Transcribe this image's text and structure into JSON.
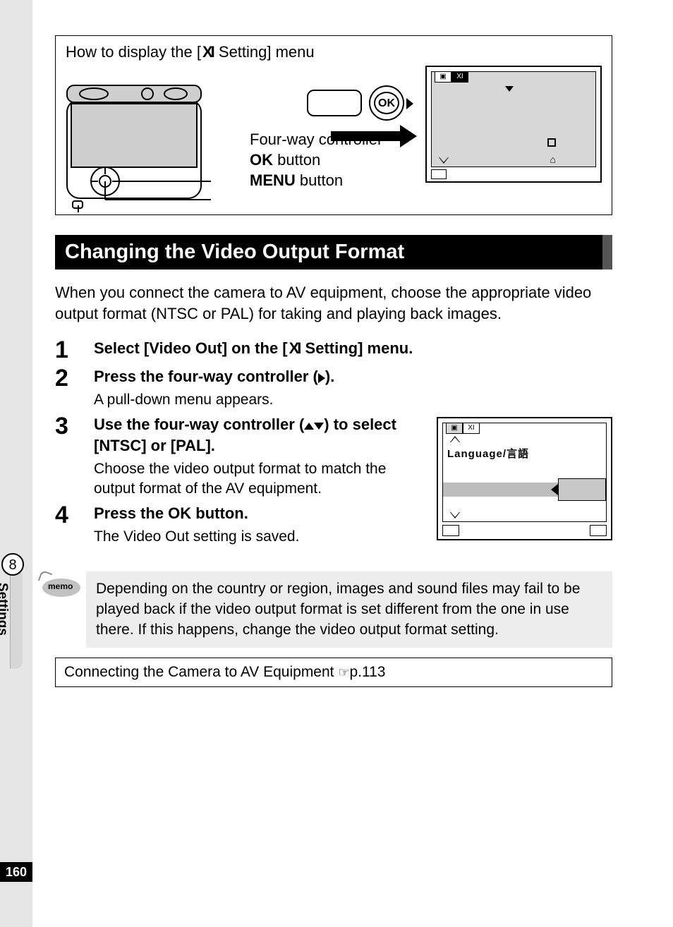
{
  "howto": {
    "title_prefix": "How to display the [",
    "title_suffix": " Setting] menu",
    "callouts": {
      "fourway": "Four-way controller",
      "ok_prefix": "OK",
      "ok_suffix": " button",
      "menu_prefix": "MENU",
      "menu_suffix": " button"
    },
    "ok_button_label": "OK"
  },
  "heading": "Changing the Video Output Format",
  "intro": "When you connect the camera to AV equipment, choose the appropriate video output format (NTSC or PAL) for taking and playing back images.",
  "steps": [
    {
      "num": "1",
      "title_prefix": "Select [Video Out] on the [",
      "title_suffix": " Setting] menu.",
      "desc": ""
    },
    {
      "num": "2",
      "title": "Press the four-way controller (▶).",
      "desc": "A pull-down menu appears."
    },
    {
      "num": "3",
      "title": "Use the four-way controller (▲▼) to select [NTSC] or [PAL].",
      "desc": "Choose the video output format to match the output format of the AV equipment."
    },
    {
      "num": "4",
      "title_prefix": "Press the ",
      "title_ok": "OK",
      "title_suffix": " button.",
      "desc": "The Video Out setting is saved."
    }
  ],
  "screen2": {
    "language_label": "Language/言語"
  },
  "memo": {
    "label": "memo",
    "text": "Depending on the country or region, images and sound files may fail to be played back if the video output format is set different from the one in use there. If this happens, change the video output format setting."
  },
  "ref": {
    "text": "Connecting the Camera to AV Equipment ",
    "page": "p.113"
  },
  "side": {
    "chapter": "8",
    "label": "Settings"
  },
  "page_number": "160"
}
